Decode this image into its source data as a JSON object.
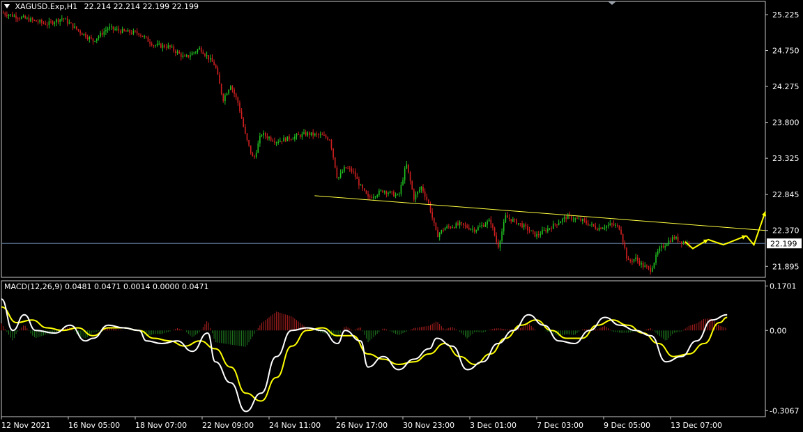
{
  "header": {
    "symbol": "XAGUSD.Exp,H1",
    "ohlc": "22.214 22.214 22.199 22.199"
  },
  "macd_header": {
    "label": "MACD(12,26,9) 0.0481 0.0471 0.0014 0.0000 0.0471"
  },
  "colors": {
    "bull": "#21c421",
    "bear": "#d22020",
    "signal": "#ffff00",
    "macd": "#ffffff",
    "grid": "#808080",
    "hist_pos": "#b02020",
    "hist_neg": "#1f7a1f"
  },
  "chart_data": [
    {
      "type": "line",
      "title": "",
      "price_ticks": [
        "25.225",
        "24.750",
        "24.275",
        "23.800",
        "23.325",
        "22.845",
        "22.370",
        "21.895"
      ],
      "ylim": [
        21.75,
        25.4
      ],
      "current_price": {
        "label": "22.199",
        "value": 22.199
      },
      "x_labels": [
        "12 Nov 2021",
        "16 Nov 05:00",
        "18 Nov 07:00",
        "22 Nov 09:00",
        "24 Nov 11:00",
        "26 Nov 17:00",
        "30 Nov 23:00",
        "3 Dec 01:00",
        "7 Dec 03:00",
        "9 Dec 05:00",
        "13 Dec 07:00"
      ],
      "trendline": [
        {
          "t": 0.41,
          "price": 22.83
        },
        {
          "t": 1.0,
          "price": 22.37
        }
      ],
      "close_path": [
        [
          0.0,
          25.25
        ],
        [
          0.02,
          25.2
        ],
        [
          0.04,
          25.15
        ],
        [
          0.06,
          25.1
        ],
        [
          0.08,
          25.18
        ],
        [
          0.1,
          25.02
        ],
        [
          0.12,
          24.88
        ],
        [
          0.14,
          25.05
        ],
        [
          0.16,
          25.0
        ],
        [
          0.18,
          24.98
        ],
        [
          0.2,
          24.82
        ],
        [
          0.22,
          24.8
        ],
        [
          0.24,
          24.65
        ],
        [
          0.26,
          24.78
        ],
        [
          0.28,
          24.55
        ],
        [
          0.29,
          24.1
        ],
        [
          0.3,
          24.3
        ],
        [
          0.31,
          24.05
        ],
        [
          0.32,
          23.6
        ],
        [
          0.33,
          23.3
        ],
        [
          0.34,
          23.65
        ],
        [
          0.36,
          23.55
        ],
        [
          0.38,
          23.6
        ],
        [
          0.4,
          23.65
        ],
        [
          0.42,
          23.62
        ],
        [
          0.43,
          23.58
        ],
        [
          0.44,
          23.05
        ],
        [
          0.45,
          23.2
        ],
        [
          0.46,
          23.15
        ],
        [
          0.47,
          22.95
        ],
        [
          0.48,
          22.8
        ],
        [
          0.5,
          22.9
        ],
        [
          0.52,
          22.82
        ],
        [
          0.53,
          23.25
        ],
        [
          0.54,
          22.8
        ],
        [
          0.55,
          22.95
        ],
        [
          0.56,
          22.7
        ],
        [
          0.57,
          22.3
        ],
        [
          0.58,
          22.4
        ],
        [
          0.6,
          22.45
        ],
        [
          0.62,
          22.38
        ],
        [
          0.64,
          22.5
        ],
        [
          0.65,
          22.15
        ],
        [
          0.66,
          22.55
        ],
        [
          0.68,
          22.45
        ],
        [
          0.7,
          22.3
        ],
        [
          0.72,
          22.42
        ],
        [
          0.74,
          22.55
        ],
        [
          0.76,
          22.5
        ],
        [
          0.78,
          22.4
        ],
        [
          0.8,
          22.45
        ],
        [
          0.81,
          22.4
        ],
        [
          0.82,
          21.95
        ],
        [
          0.83,
          22.0
        ],
        [
          0.84,
          21.9
        ],
        [
          0.85,
          21.85
        ],
        [
          0.86,
          22.1
        ],
        [
          0.87,
          22.2
        ],
        [
          0.88,
          22.28
        ],
        [
          0.89,
          22.22
        ],
        [
          0.9,
          22.199
        ]
      ],
      "forecast_arrows": [
        [
          [
            0.895,
            22.22
          ],
          [
            0.905,
            22.13
          ],
          [
            0.925,
            22.25
          ]
        ],
        [
          [
            0.925,
            22.25
          ],
          [
            0.945,
            22.18
          ],
          [
            0.975,
            22.3
          ]
        ],
        [
          [
            0.975,
            22.3
          ],
          [
            0.985,
            22.18
          ],
          [
            1.0,
            22.62
          ]
        ]
      ]
    },
    {
      "type": "bar",
      "title": "",
      "ticks": [
        "0.1701",
        "0.00",
        "-0.3067"
      ],
      "ylim": [
        -0.33,
        0.19
      ],
      "macd_path": [
        [
          0.0,
          0.12
        ],
        [
          0.015,
          0.0
        ],
        [
          0.03,
          0.06
        ],
        [
          0.045,
          0.0
        ],
        [
          0.07,
          -0.01
        ],
        [
          0.09,
          0.02
        ],
        [
          0.11,
          -0.04
        ],
        [
          0.12,
          -0.03
        ],
        [
          0.14,
          0.02
        ],
        [
          0.16,
          0.01
        ],
        [
          0.18,
          0.0
        ],
        [
          0.19,
          -0.04
        ],
        [
          0.21,
          -0.05
        ],
        [
          0.23,
          -0.04
        ],
        [
          0.25,
          -0.08
        ],
        [
          0.27,
          -0.01
        ],
        [
          0.28,
          -0.12
        ],
        [
          0.3,
          -0.2
        ],
        [
          0.32,
          -0.31
        ],
        [
          0.34,
          -0.24
        ],
        [
          0.36,
          -0.1
        ],
        [
          0.38,
          0.0
        ],
        [
          0.4,
          0.01
        ],
        [
          0.42,
          0.0
        ],
        [
          0.44,
          -0.05
        ],
        [
          0.45,
          0.0
        ],
        [
          0.47,
          -0.04
        ],
        [
          0.48,
          -0.14
        ],
        [
          0.5,
          -0.1
        ],
        [
          0.52,
          -0.15
        ],
        [
          0.54,
          -0.11
        ],
        [
          0.56,
          -0.07
        ],
        [
          0.57,
          -0.03
        ],
        [
          0.59,
          -0.06
        ],
        [
          0.61,
          -0.15
        ],
        [
          0.63,
          -0.12
        ],
        [
          0.65,
          -0.05
        ],
        [
          0.67,
          0.0
        ],
        [
          0.69,
          0.06
        ],
        [
          0.71,
          0.02
        ],
        [
          0.73,
          -0.04
        ],
        [
          0.75,
          -0.05
        ],
        [
          0.77,
          0.0
        ],
        [
          0.79,
          0.05
        ],
        [
          0.81,
          0.02
        ],
        [
          0.83,
          0.0
        ],
        [
          0.85,
          -0.02
        ],
        [
          0.87,
          -0.12
        ],
        [
          0.89,
          -0.1
        ],
        [
          0.91,
          -0.04
        ],
        [
          0.93,
          0.04
        ],
        [
          0.95,
          0.06
        ]
      ],
      "signal_path": [
        [
          0.0,
          0.09
        ],
        [
          0.02,
          0.03
        ],
        [
          0.04,
          0.04
        ],
        [
          0.06,
          0.01
        ],
        [
          0.08,
          0.0
        ],
        [
          0.1,
          0.01
        ],
        [
          0.12,
          -0.02
        ],
        [
          0.14,
          0.01
        ],
        [
          0.16,
          0.01
        ],
        [
          0.18,
          0.0
        ],
        [
          0.2,
          -0.03
        ],
        [
          0.22,
          -0.04
        ],
        [
          0.24,
          -0.06
        ],
        [
          0.26,
          -0.04
        ],
        [
          0.28,
          -0.07
        ],
        [
          0.3,
          -0.14
        ],
        [
          0.32,
          -0.24
        ],
        [
          0.34,
          -0.27
        ],
        [
          0.36,
          -0.18
        ],
        [
          0.38,
          -0.06
        ],
        [
          0.4,
          0.0
        ],
        [
          0.42,
          0.01
        ],
        [
          0.44,
          -0.02
        ],
        [
          0.46,
          -0.02
        ],
        [
          0.48,
          -0.09
        ],
        [
          0.5,
          -0.11
        ],
        [
          0.52,
          -0.13
        ],
        [
          0.54,
          -0.12
        ],
        [
          0.56,
          -0.09
        ],
        [
          0.58,
          -0.05
        ],
        [
          0.6,
          -0.1
        ],
        [
          0.62,
          -0.13
        ],
        [
          0.64,
          -0.09
        ],
        [
          0.66,
          -0.03
        ],
        [
          0.68,
          0.02
        ],
        [
          0.7,
          0.04
        ],
        [
          0.72,
          0.0
        ],
        [
          0.74,
          -0.03
        ],
        [
          0.76,
          -0.03
        ],
        [
          0.78,
          0.02
        ],
        [
          0.8,
          0.04
        ],
        [
          0.82,
          0.02
        ],
        [
          0.84,
          -0.01
        ],
        [
          0.86,
          -0.05
        ],
        [
          0.88,
          -0.1
        ],
        [
          0.9,
          -0.09
        ],
        [
          0.92,
          -0.05
        ],
        [
          0.94,
          0.03
        ],
        [
          0.95,
          0.05
        ]
      ]
    }
  ]
}
